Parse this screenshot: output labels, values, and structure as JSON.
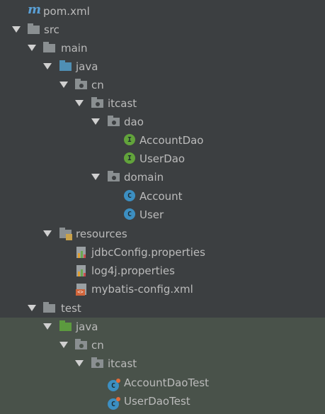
{
  "tree": {
    "rows": [
      {
        "label": "pom.xml",
        "icon": "maven-icon",
        "glyph": "m"
      },
      {
        "label": "src",
        "icon": "folder-icon"
      },
      {
        "label": "main",
        "icon": "folder-icon"
      },
      {
        "label": "java",
        "icon": "source-folder-icon"
      },
      {
        "label": "cn",
        "icon": "package-icon"
      },
      {
        "label": "itcast",
        "icon": "package-icon"
      },
      {
        "label": "dao",
        "icon": "package-icon"
      },
      {
        "label": "AccountDao",
        "icon": "interface-icon",
        "glyph": "I"
      },
      {
        "label": "UserDao",
        "icon": "interface-icon",
        "glyph": "I"
      },
      {
        "label": "domain",
        "icon": "package-icon"
      },
      {
        "label": "Account",
        "icon": "class-icon",
        "glyph": "C"
      },
      {
        "label": "User",
        "icon": "class-icon",
        "glyph": "C"
      },
      {
        "label": "resources",
        "icon": "resources-folder-icon"
      },
      {
        "label": "jdbcConfig.properties",
        "icon": "properties-file-icon"
      },
      {
        "label": "log4j.properties",
        "icon": "properties-file-icon"
      },
      {
        "label": "mybatis-config.xml",
        "icon": "xml-file-icon",
        "glyph": "<>"
      },
      {
        "label": "test",
        "icon": "folder-icon"
      },
      {
        "label": "java",
        "icon": "test-source-folder-icon"
      },
      {
        "label": "cn",
        "icon": "package-icon"
      },
      {
        "label": "itcast",
        "icon": "package-icon"
      },
      {
        "label": "AccountDaoTest",
        "icon": "test-class-icon",
        "glyph": "C"
      },
      {
        "label": "UserDaoTest",
        "icon": "test-class-icon",
        "glyph": "C"
      }
    ]
  },
  "colors": {
    "background": "#3c3f41",
    "test_background": "#49524a",
    "text": "#bbbbbb",
    "interface": "#62a33b",
    "class": "#3c8fc2",
    "source_folder": "#4f8fb4",
    "test_source_folder": "#5c9a3f"
  }
}
